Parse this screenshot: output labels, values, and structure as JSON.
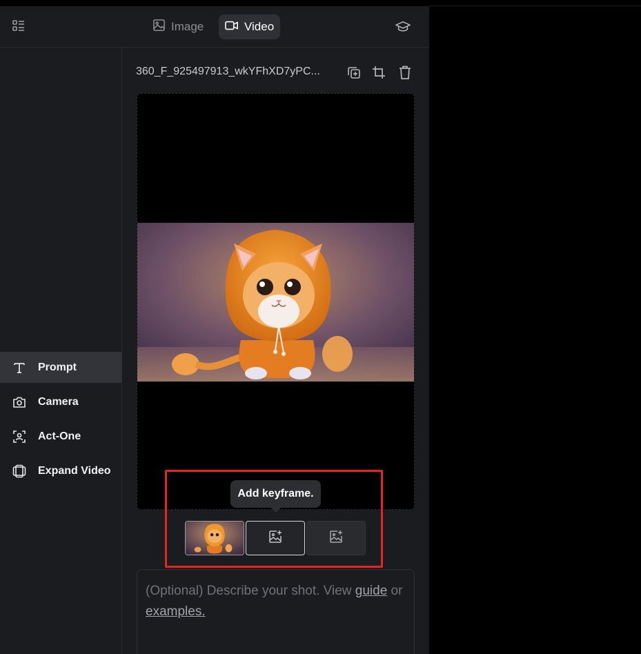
{
  "header": {
    "menu_icon": "list-menu-icon",
    "tabs": [
      {
        "label": "Image",
        "icon": "image-icon"
      },
      {
        "label": "Video",
        "icon": "video-camera-icon"
      }
    ],
    "learn_icon": "graduation-cap-icon"
  },
  "sidebar": {
    "items": [
      {
        "label": "Prompt",
        "icon": "text-t-icon",
        "active": true
      },
      {
        "label": "Camera",
        "icon": "camera-icon"
      },
      {
        "label": "Act-One",
        "icon": "face-scan-icon"
      },
      {
        "label": "Expand Video",
        "icon": "expand-frame-icon"
      }
    ]
  },
  "file": {
    "name": "360_F_925497913_wkYFhXD7yPC...",
    "actions": [
      "duplicate-icon",
      "crop-icon",
      "trash-icon"
    ]
  },
  "preview": {
    "image": "orange-kitten-in-hoodie"
  },
  "tooltip": {
    "text": "Add keyframe."
  },
  "keyframes": {
    "slots": [
      "first-frame-thumbnail",
      "add-keyframe-icon",
      "add-keyframe-icon"
    ]
  },
  "prompt": {
    "prefix": "(Optional) Describe your shot. View ",
    "guide_link": "guide",
    "middle": " or ",
    "examples_link": "examples."
  },
  "colors": {
    "panel_bg": "#1b1c1f",
    "active_tab_bg": "#2f3035",
    "highlight": "#e8241c"
  }
}
